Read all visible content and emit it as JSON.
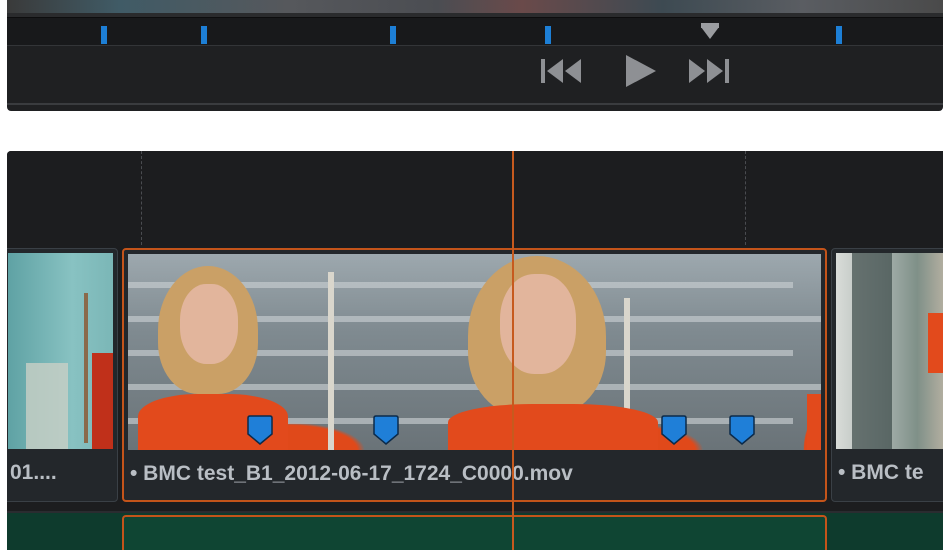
{
  "viewer": {
    "markers": [
      {
        "name": "marker-1"
      },
      {
        "name": "marker-2"
      },
      {
        "name": "marker-3"
      },
      {
        "name": "marker-4"
      },
      {
        "name": "marker-5"
      }
    ],
    "transport": {
      "previous_icon": "skip-back-icon",
      "play_icon": "play-icon",
      "next_icon": "skip-forward-icon"
    }
  },
  "timeline": {
    "clips": [
      {
        "label": "01...."
      },
      {
        "label": "• BMC test_B1_2012-06-17_1724_C0000.mov"
      },
      {
        "label": "• BMC te"
      }
    ],
    "marker_icon": "marker-shield-icon"
  },
  "colors": {
    "accent_orange": "#c4541a",
    "marker_blue": "#1d7fd6",
    "audio_green": "#0e3b2d",
    "panel_bg": "#1c1d1f"
  }
}
